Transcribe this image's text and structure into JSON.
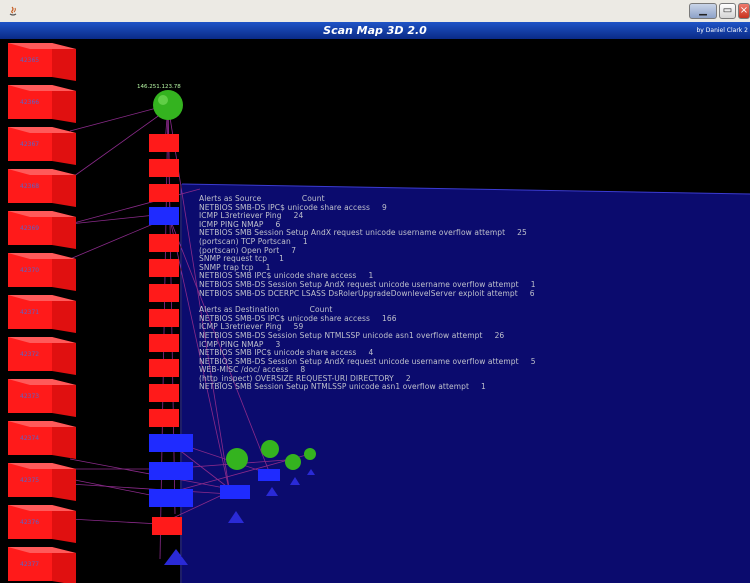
{
  "window": {
    "title": "",
    "controls": [
      "minimize",
      "maximize",
      "close"
    ]
  },
  "header": {
    "title": "Scan Map 3D 2.0",
    "byline": "by Daniel Clark 2"
  },
  "colors": {
    "title_bar": "#0a2a86",
    "panel": "#0b0b6e",
    "alert_block": "#ff1a1a",
    "selected_block": "#1f2bff",
    "node": "#34b31f",
    "link": "#8a2a8a"
  },
  "ip_blocks": [
    {
      "label": "42365"
    },
    {
      "label": "42366"
    },
    {
      "label": "42367"
    },
    {
      "label": "42368"
    },
    {
      "label": "42369"
    },
    {
      "label": "42370"
    },
    {
      "label": "42371"
    },
    {
      "label": "42372"
    },
    {
      "label": "42373"
    },
    {
      "label": "42374"
    },
    {
      "label": "42375"
    },
    {
      "label": "42376"
    },
    {
      "label": "42377"
    }
  ],
  "nodes": {
    "top_label": "146.251.123.78"
  },
  "alerts": {
    "source_header": "Alerts as Source",
    "source_count_header": "Count",
    "source_rows": [
      {
        "name": "NETBIOS SMB-DS IPC$ unicode share access",
        "count": "9"
      },
      {
        "name": "ICMP L3retriever Ping",
        "count": "24"
      },
      {
        "name": "ICMP PING NMAP",
        "count": "6"
      },
      {
        "name": "NETBIOS SMB Session Setup AndX request unicode username overflow attempt",
        "count": "25"
      },
      {
        "name": "(portscan) TCP Portscan",
        "count": "1"
      },
      {
        "name": "(portscan) Open Port",
        "count": "7"
      },
      {
        "name": "SNMP request tcp",
        "count": "1"
      },
      {
        "name": "SNMP trap tcp",
        "count": "1"
      },
      {
        "name": "NETBIOS SMB IPC$ unicode share access",
        "count": "1"
      },
      {
        "name": "NETBIOS SMB-DS Session Setup AndX request unicode username overflow attempt",
        "count": "1"
      },
      {
        "name": "NETBIOS SMB-DS DCERPC LSASS DsRolerUpgradeDownlevelServer exploit attempt",
        "count": "6"
      }
    ],
    "dest_header": "Alerts as Destination",
    "dest_count_header": "Count",
    "dest_rows": [
      {
        "name": "NETBIOS SMB-DS IPC$ unicode share access",
        "count": "166"
      },
      {
        "name": "ICMP L3retriever Ping",
        "count": "59"
      },
      {
        "name": "NETBIOS SMB-DS Session Setup NTMLSSP unicode asn1 overflow attempt",
        "count": "26"
      },
      {
        "name": "ICMP PING NMAP",
        "count": "3"
      },
      {
        "name": "NETBIOS SMB IPC$ unicode share access",
        "count": "4"
      },
      {
        "name": "NETBIOS SMB-DS Session Setup AndX request unicode username overflow attempt",
        "count": "5"
      },
      {
        "name": "WEB-MISC /doc/ access",
        "count": "8"
      },
      {
        "name": "(http_inspect) OVERSIZE REQUEST-URI DIRECTORY",
        "count": "2"
      },
      {
        "name": "NETBIOS SMB Session Setup NTMLSSP unicode asn1 overflow attempt",
        "count": "1"
      }
    ]
  }
}
